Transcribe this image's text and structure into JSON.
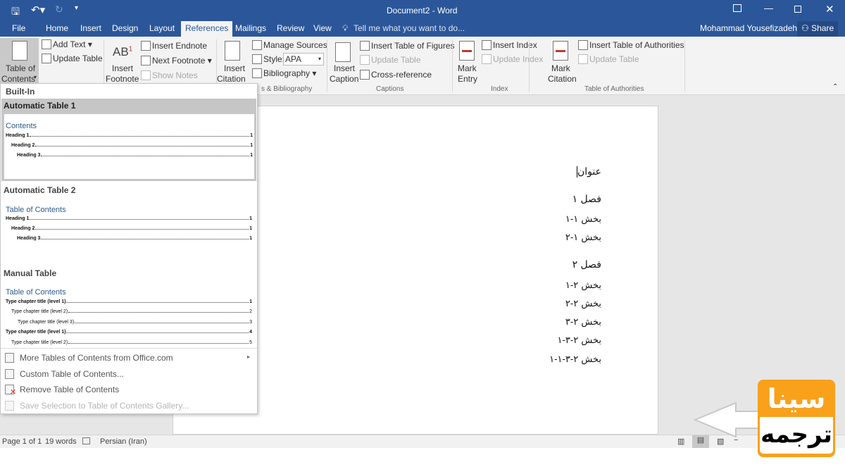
{
  "window": {
    "title": "Document2 - Word",
    "user": "Mohammad Yousefizadeh",
    "share": "Share"
  },
  "tabs": [
    "File",
    "Home",
    "Insert",
    "Design",
    "Layout",
    "References",
    "Mailings",
    "Review",
    "View"
  ],
  "active_tab": "References",
  "tell_me": "Tell me what you want to do...",
  "ribbon": {
    "toc": {
      "big": "Table of",
      "big2": "Contents",
      "add_text": "Add Text",
      "update": "Update Table"
    },
    "footnotes": {
      "insert1": "Insert",
      "insert2": "Footnote",
      "endnote": "Insert Endnote",
      "next": "Next Footnote",
      "show": "Show Notes",
      "ab": "AB",
      "sup": "1"
    },
    "citations": {
      "insert1": "Insert",
      "insert2": "Citation",
      "manage": "Manage Sources",
      "style_label": "Style:",
      "style_value": "APA",
      "bib": "Bibliography",
      "group": "s & Bibliography"
    },
    "captions": {
      "insert1": "Insert",
      "insert2": "Caption",
      "tof": "Insert Table of Figures",
      "update": "Update Table",
      "cross": "Cross-reference",
      "group": "Captions"
    },
    "index": {
      "mark1": "Mark",
      "mark2": "Entry",
      "insert": "Insert Index",
      "update": "Update Index",
      "group": "Index"
    },
    "toa": {
      "mark1": "Mark",
      "mark2": "Citation",
      "insert": "Insert Table of Authorities",
      "update": "Update Table",
      "group": "Table of Authorities"
    }
  },
  "menu": {
    "builtin": "Built-In",
    "auto1": {
      "title": "Automatic Table 1",
      "heading": "Contents",
      "lines": [
        {
          "t": "Heading 1",
          "p": "1"
        },
        {
          "t": "Heading 2",
          "p": "1"
        },
        {
          "t": "Heading 3",
          "p": "1"
        }
      ]
    },
    "auto2": {
      "title": "Automatic Table 2",
      "heading": "Table of Contents",
      "lines": [
        {
          "t": "Heading 1",
          "p": "1"
        },
        {
          "t": "Heading 2",
          "p": "1"
        },
        {
          "t": "Heading 3",
          "p": "1"
        }
      ]
    },
    "manual": {
      "title": "Manual Table",
      "heading": "Table of Contents",
      "lines": [
        {
          "t": "Type chapter title (level 1)",
          "p": "1"
        },
        {
          "t": "Type chapter title (level 2)",
          "p": "2"
        },
        {
          "t": "Type chapter title (level 3)",
          "p": "3"
        },
        {
          "t": "Type chapter title (level 1)",
          "p": "4"
        },
        {
          "t": "Type chapter title (level 2)",
          "p": "5"
        }
      ]
    },
    "items": [
      "More Tables of Contents from Office.com",
      "Custom Table of Contents...",
      "Remove Table of Contents",
      "Save Selection to Table of Contents Gallery..."
    ]
  },
  "document": {
    "lines": [
      "عنوان",
      "فصل ۱",
      "بخش ۱-۱",
      "بخش ۱-۲",
      "فصل ۲",
      "بخش ۲-۱",
      "بخش ۲-۲",
      "بخش ۲-۳",
      "بخش ۲-۳-۱",
      "بخش ۲-۳-۱-۱"
    ]
  },
  "status": {
    "page": "Page 1 of 1",
    "words": "19 words",
    "language": "Persian (Iran)"
  },
  "watermark": {
    "top": "سینا",
    "bottom": "ترجمه"
  },
  "colors": {
    "brand": "#2b579a",
    "logo": "#f9a11b"
  }
}
